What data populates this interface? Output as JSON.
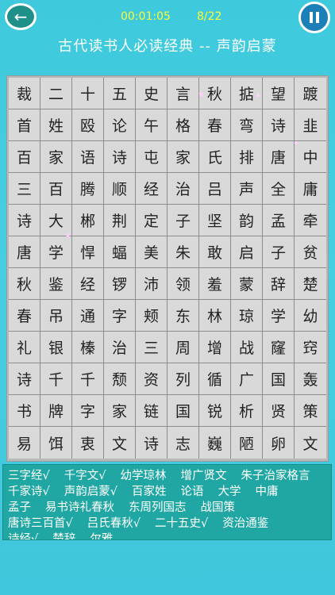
{
  "header": {
    "back_label": "←",
    "timer": "00:01:05",
    "progress": "8/22",
    "pause_icon": "pause-icon"
  },
  "title": "古代读书人必读经典 -- 声韵启蒙",
  "grid": [
    [
      "裁",
      "二",
      "十",
      "五",
      "史",
      "言",
      "秋",
      "掂",
      "望",
      "踱"
    ],
    [
      "首",
      "姓",
      "殴",
      "论",
      "午",
      "格",
      "春",
      "弯",
      "诗",
      "韭"
    ],
    [
      "百",
      "家",
      "语",
      "诗",
      "屯",
      "家",
      "氏",
      "排",
      "唐",
      "中"
    ],
    [
      "三",
      "百",
      "腾",
      "顺",
      "经",
      "治",
      "吕",
      "声",
      "全",
      "庸"
    ],
    [
      "诗",
      "大",
      "郴",
      "荆",
      "定",
      "子",
      "坚",
      "韵",
      "孟",
      "牵"
    ],
    [
      "唐",
      "学",
      "悍",
      "蝠",
      "美",
      "朱",
      "敢",
      "启",
      "子",
      "贫"
    ],
    [
      "秋",
      "鉴",
      "经",
      "锣",
      "沛",
      "领",
      "羞",
      "蒙",
      "辞",
      "楚"
    ],
    [
      "春",
      "吊",
      "通",
      "字",
      "颊",
      "东",
      "林",
      "琼",
      "学",
      "幼"
    ],
    [
      "礼",
      "银",
      "榛",
      "治",
      "三",
      "周",
      "增",
      "战",
      "窿",
      "窍"
    ],
    [
      "诗",
      "千",
      "千",
      "颓",
      "资",
      "列",
      "循",
      "广",
      "国",
      "轰"
    ],
    [
      "书",
      "牌",
      "字",
      "家",
      "链",
      "国",
      "锐",
      "析",
      "贤",
      "策"
    ],
    [
      "易",
      "饵",
      "衷",
      "文",
      "诗",
      "志",
      "巍",
      "陋",
      "卵",
      "文"
    ]
  ],
  "words": [
    "三字经√",
    "千字文√",
    "幼学琼林",
    "增广贤文",
    "朱子治家格言",
    "千家诗√",
    "声韵启蒙√",
    "百家姓",
    "论语",
    "大学",
    "中庸",
    "孟子",
    "易书诗礼春秋",
    "东周列国志",
    "战国策",
    "唐诗三百首√",
    "吕氏春秋√",
    "二十五史√",
    "资治通鉴",
    "诗经√",
    "楚辞",
    "尔雅"
  ],
  "colors": {
    "highlight": "#6a6ee8",
    "timer": "#ffff33"
  }
}
